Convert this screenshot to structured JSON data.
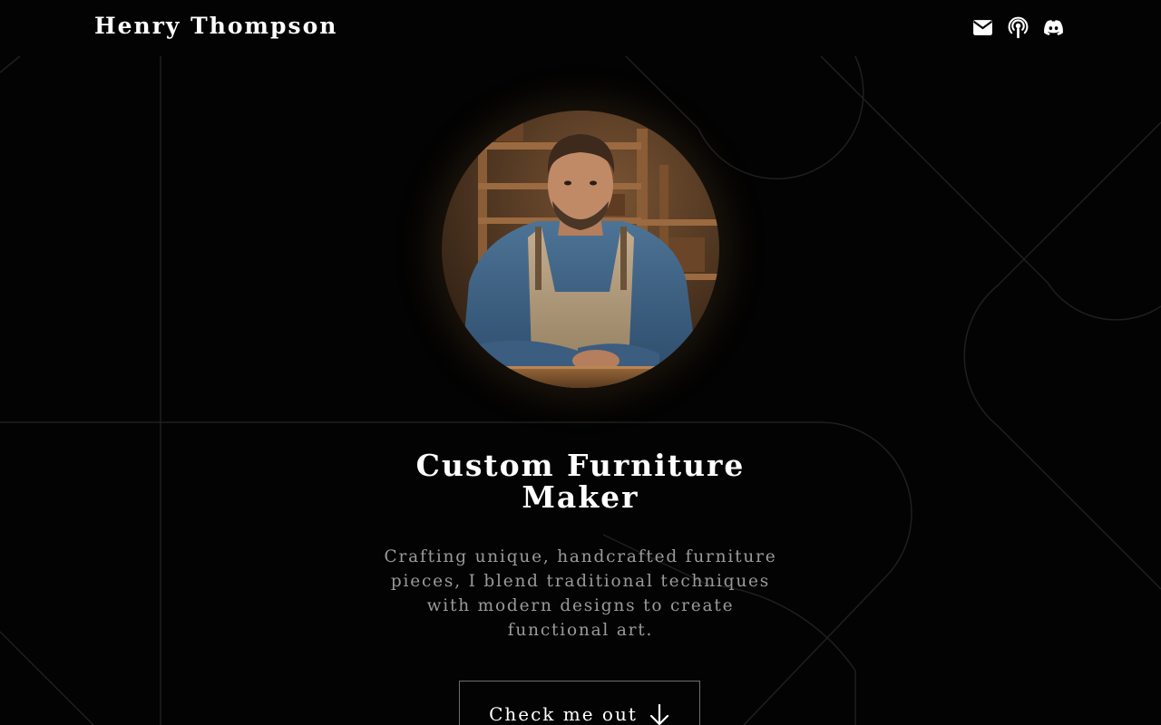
{
  "header": {
    "brand": "Henry Thompson",
    "social": [
      {
        "name": "email-icon",
        "label": "Email"
      },
      {
        "name": "podcast-icon",
        "label": "Podcast"
      },
      {
        "name": "discord-icon",
        "label": "Discord"
      }
    ]
  },
  "hero": {
    "portrait_alt": "Portrait of a woodworker in a workshop wearing a canvas apron",
    "title_line1": "Custom Furniture",
    "title_line2": "Maker",
    "subtitle_line1": "Crafting unique, handcrafted furniture",
    "subtitle_line2": "pieces, I blend traditional techniques",
    "subtitle_line3": "with modern designs to create",
    "subtitle_line4": "functional art.",
    "cta_label": "Check me out",
    "cta_icon": "arrow-down-icon"
  },
  "colors": {
    "background": "#030303",
    "text": "#ffffff",
    "muted_text": "#9a9a9a",
    "line": "#1f1f1f",
    "button_border": "#6e6e6e"
  }
}
